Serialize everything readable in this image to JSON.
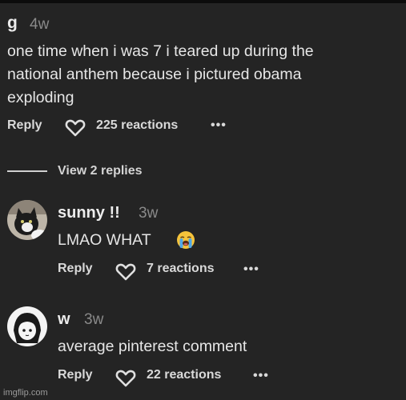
{
  "comment": {
    "username": "g",
    "age": "4w",
    "text_lines": [
      "one time when i was 7 i teared up during the",
      "national anthem because i pictured obama",
      "exploding"
    ],
    "reply_label": "Reply",
    "reactions": "225 reactions",
    "more": "•••"
  },
  "view_replies": "View 2 replies",
  "replies": [
    {
      "username": "sunny !!",
      "age": "3w",
      "text": "LMAO WHAT",
      "emoji": "loudly-crying-face-emoji",
      "reply_label": "Reply",
      "reactions": "7 reactions",
      "more": "•••"
    },
    {
      "username": "w",
      "age": "3w",
      "text": "average pinterest comment",
      "reply_label": "Reply",
      "reactions": "22 reactions",
      "more": "•••"
    }
  ],
  "watermark": "imgflip.com",
  "colors": {
    "background": "#242424",
    "text": "#e6e6e6",
    "muted": "#8a8a8a"
  }
}
